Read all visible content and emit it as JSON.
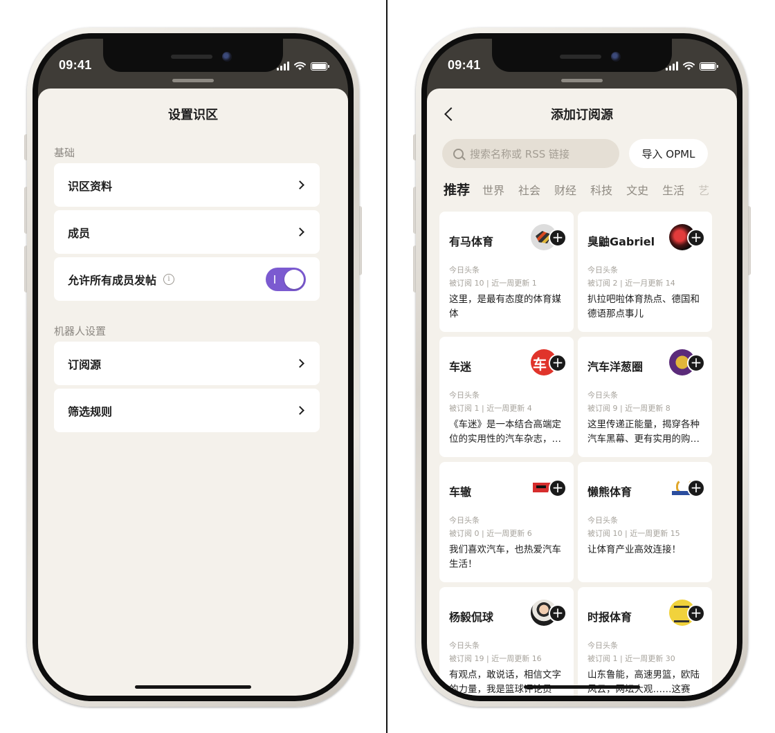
{
  "status": {
    "time": "09:41"
  },
  "left": {
    "title": "设置识区",
    "sections": [
      {
        "label": "基础"
      },
      {
        "label": "机器人设置"
      }
    ],
    "rows": [
      {
        "label": "识区资料"
      },
      {
        "label": "成员"
      },
      {
        "label": "允许所有成员发帖",
        "toggle": "on",
        "info_icon": "info-icon"
      },
      {
        "label": "订阅源"
      },
      {
        "label": "筛选规则"
      }
    ]
  },
  "right": {
    "title": "添加订阅源",
    "search_placeholder": "搜索名称或 RSS 链接",
    "import_label": "导入 OPML",
    "tabs": [
      "推荐",
      "世界",
      "社会",
      "财经",
      "科技",
      "文史",
      "生活",
      "艺"
    ],
    "active_tab": "推荐",
    "cards": [
      {
        "name": "有马体育",
        "source": "今日头条",
        "stats": "被订阅 10 | 近一周更新 1",
        "desc": "这里，是最有态度的体育媒体"
      },
      {
        "name": "臭鼬Gabriel",
        "source": "今日头条",
        "stats": "被订阅 2 | 近一月更新 14",
        "desc": "扒拉吧啦体育热点、德国和德语那点事儿"
      },
      {
        "name": "车迷",
        "source": "今日头条",
        "stats": "被订阅 1 | 近一周更新 4",
        "desc": "《车迷》是一本结合高端定位的实用性的汽车杂志，以及丰富的汽车文化"
      },
      {
        "name": "汽车洋葱圈",
        "source": "今日头条",
        "stats": "被订阅 9 | 近一周更新 8",
        "desc": "这里传递正能量，揭穿各种汽车黑幕、更有实用的购车指南"
      },
      {
        "name": "车辙",
        "source": "今日头条",
        "stats": "被订阅 0 | 近一周更新 6",
        "desc": "我们喜欢汽车，也热爱汽车生活！"
      },
      {
        "name": "懒熊体育",
        "source": "今日头条",
        "stats": "被订阅 10 | 近一周更新 15",
        "desc": "让体育产业高效连接！"
      },
      {
        "name": "杨毅侃球",
        "source": "今日头条",
        "stats": "被订阅 19 | 近一周更新 16",
        "desc": "有观点，敢说话，相信文字的力量，我是篮球评论员"
      },
      {
        "name": "时报体育",
        "source": "今日头条",
        "stats": "被订阅 1 | 近一周更新 30",
        "desc": "山东鲁能，高速男篮，欧陆风云，网坛大观……这赛"
      }
    ]
  },
  "colors": {
    "toggle_on": "#7b5ad0",
    "sheet_bg": "#f4f1eb",
    "search_bg": "#e5dfd5"
  }
}
